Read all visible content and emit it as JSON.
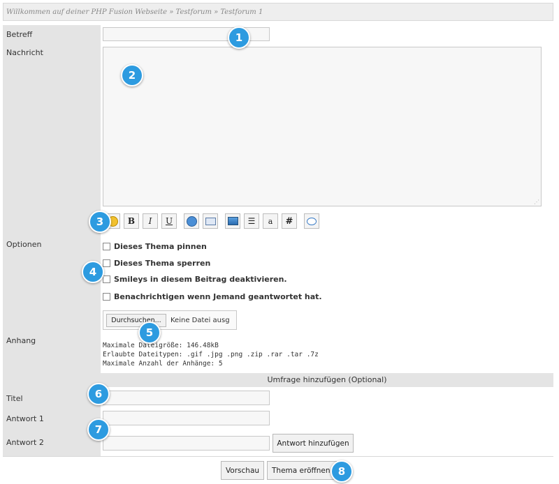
{
  "breadcrumb": "Willkommen auf deiner PHP Fusion Webseite » Testforum » Testforum 1",
  "labels": {
    "subject": "Betreff",
    "message": "Nachricht",
    "options": "Optionen",
    "attachment": "Anhang",
    "poll_title": "Titel",
    "answer1": "Antwort 1",
    "answer2": "Antwort 2"
  },
  "toolbar": {
    "bold": "B",
    "italic": "I",
    "underline": "U",
    "small": "a",
    "hash": "#"
  },
  "options": {
    "pin": "Dieses Thema pinnen",
    "lock": "Dieses Thema sperren",
    "smileys": "Smileys in diesem Beitrag deaktivieren.",
    "notify": "Benachrichtigen wenn Jemand geantwortet hat."
  },
  "attachment": {
    "browse_label": "Durchsuchen...",
    "no_file": "Keine Datei ausg",
    "max_size": "Maximale Dateigröße: 146.48kB",
    "allowed_types": "Erlaubte Dateitypen: .gif .jpg .png .zip .rar .tar .7z",
    "max_count": "Maximale Anzahl der Anhänge: 5"
  },
  "poll": {
    "header": "Umfrage hinzufügen (Optional)",
    "add_answer": "Antwort hinzufügen"
  },
  "actions": {
    "preview": "Vorschau",
    "create": "Thema eröffnen"
  },
  "markers": [
    "1",
    "2",
    "3",
    "4",
    "5",
    "6",
    "7",
    "8"
  ],
  "colors": {
    "marker": "#2d9be0",
    "label_col": "#e4e4e4"
  }
}
